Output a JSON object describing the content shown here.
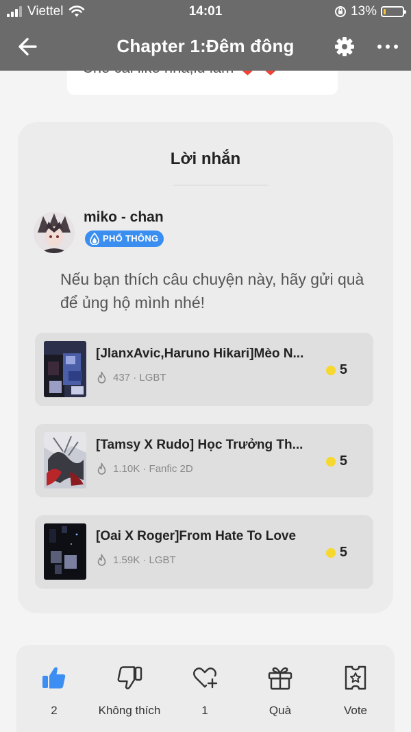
{
  "status_bar": {
    "carrier": "Viettel",
    "time": "14:01",
    "battery_percent": "13%",
    "battery_level": 0.13,
    "icons": [
      "signal-icon",
      "wifi-icon",
      "rotation-lock-icon",
      "battery-icon"
    ]
  },
  "nav": {
    "title": "Chapter 1:Đêm đông",
    "icons": [
      "back-arrow-icon",
      "gear-icon",
      "more-dots-icon"
    ]
  },
  "peek_comment": {
    "text": "Cho cái like nha,iu lắm ❤️ ❤️"
  },
  "message_panel": {
    "title": "Lời nhắn",
    "author": {
      "name": "miko - chan",
      "badge": "PHỔ THÔNG"
    },
    "message": "Nếu bạn thích câu chuyện này, hãy gửi quà để ủng hộ mình nhé!",
    "stories": [
      {
        "title": "[JlanxAvic,Haruno Hikari]Mèo N...",
        "meta": "437 · LGBT",
        "price": "5"
      },
      {
        "title": "[Tamsy X Rudo] Học Trưởng Th...",
        "meta": "1.10K · Fanfic 2D",
        "price": "5"
      },
      {
        "title": "[Oai X Roger]From Hate To Love",
        "meta": "1.59K · LGBT",
        "price": "5"
      }
    ]
  },
  "actions": [
    {
      "label": "2",
      "icon": "thumbs-up-icon"
    },
    {
      "label": "Không thích",
      "icon": "thumbs-down-icon"
    },
    {
      "label": "1",
      "icon": "heart-plus-icon"
    },
    {
      "label": "Quà",
      "icon": "gift-icon"
    },
    {
      "label": "Vote",
      "icon": "vote-ticket-icon"
    }
  ],
  "colors": {
    "header_bg": "#6b6b6b",
    "accent_blue": "#3a8ef0",
    "coin_yellow": "#f6d82e",
    "panel_bg": "#ececed"
  }
}
